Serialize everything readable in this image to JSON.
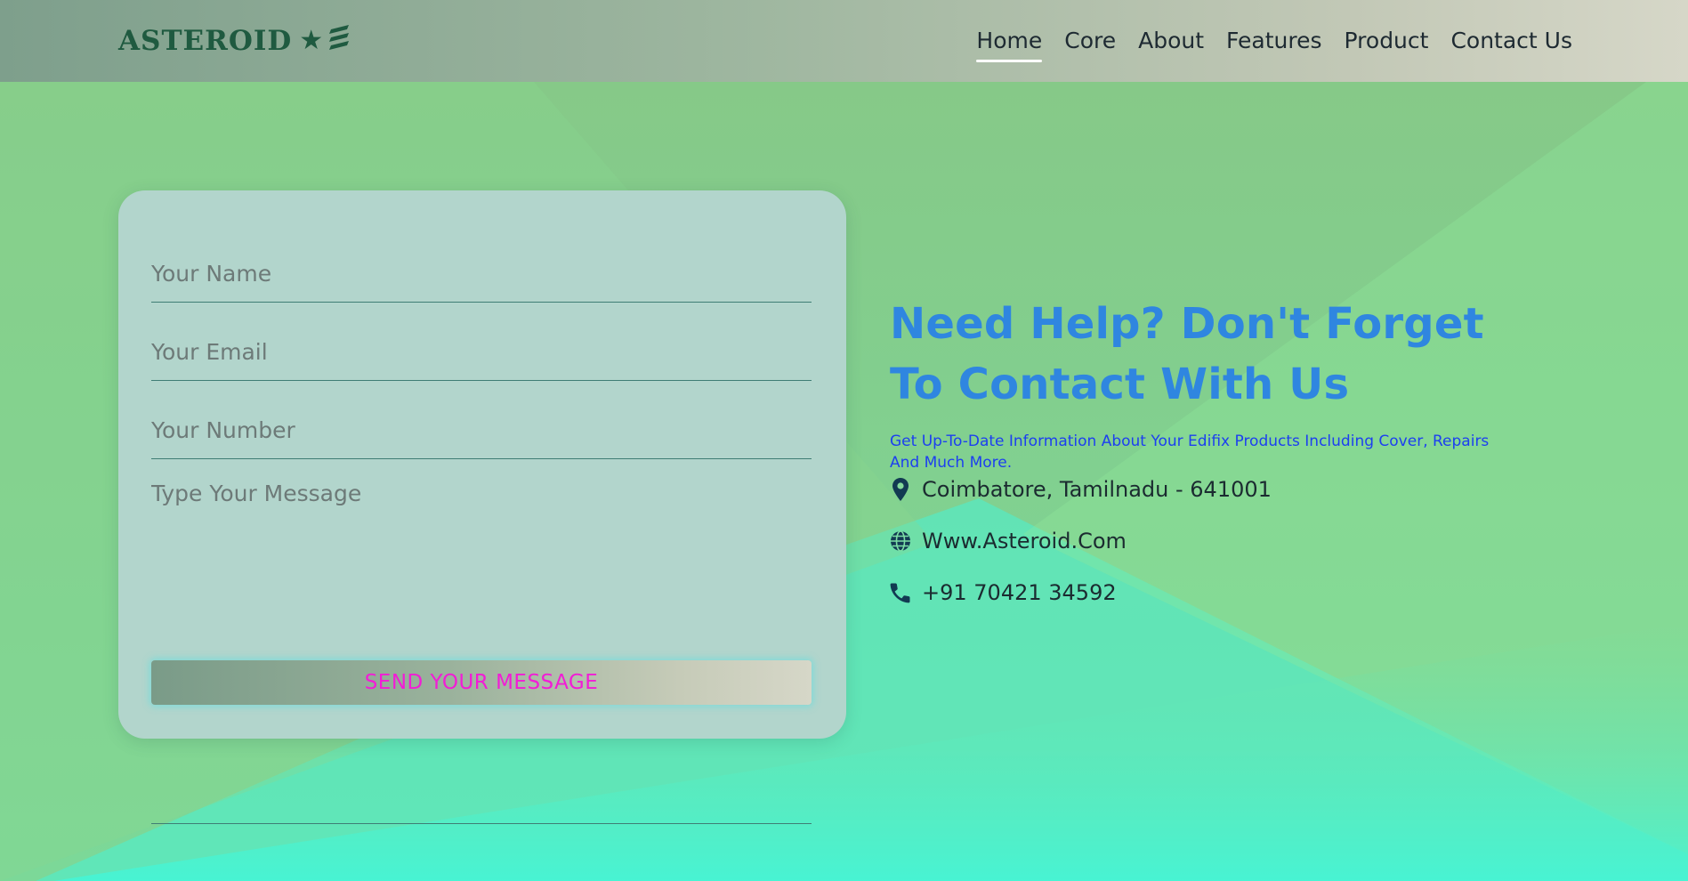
{
  "header": {
    "logo_text": "ASTEROID",
    "logo_star": "★",
    "nav": [
      {
        "label": "Home",
        "active": true
      },
      {
        "label": "Core",
        "active": false
      },
      {
        "label": "About",
        "active": false
      },
      {
        "label": "Features",
        "active": false
      },
      {
        "label": "Product",
        "active": false
      },
      {
        "label": "Contact Us",
        "active": false
      }
    ]
  },
  "form": {
    "name_placeholder": "Your Name",
    "email_placeholder": "Your Email",
    "number_placeholder": "Your Number",
    "message_placeholder": "Type Your Message",
    "send_label": "SEND YOUR MESSAGE"
  },
  "info": {
    "title": "Need Help? Don't Forget To Contact With Us",
    "subtitle": "Get Up-To-Date Information About Your Edifix Products Including Cover, Repairs And Much More.",
    "location": {
      "icon": "map-pin-icon",
      "text": "Coimbatore, Tamilnadu - 641001"
    },
    "website": {
      "icon": "globe-icon",
      "text": "Www.Asteroid.Com"
    },
    "phone": {
      "icon": "phone-icon",
      "text": "+91 70421 34592"
    }
  },
  "colors": {
    "title": "#2f86e0",
    "subtitle": "#1c3ff0",
    "send_label": "#f21cd6",
    "logo": "#1f5a40",
    "icon": "#123a52"
  }
}
